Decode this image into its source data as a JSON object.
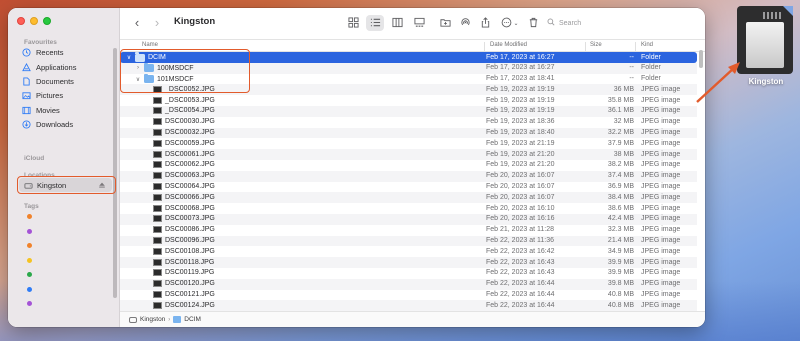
{
  "window": {
    "title": "Kingston",
    "search_placeholder": "Search"
  },
  "sidebar": {
    "favourites_label": "Favourites",
    "favourites": [
      {
        "label": "Recents",
        "icon": "clock-icon"
      },
      {
        "label": "Applications",
        "icon": "applications-icon"
      },
      {
        "label": "Documents",
        "icon": "document-icon"
      },
      {
        "label": "Pictures",
        "icon": "pictures-icon"
      },
      {
        "label": "Movies",
        "icon": "film-icon"
      },
      {
        "label": "Downloads",
        "icon": "download-icon"
      }
    ],
    "icloud_label": "iCloud",
    "locations_label": "Locations",
    "location": {
      "label": "Kingston",
      "icon": "external-drive-icon"
    },
    "tags_label": "Tags",
    "tag_colors": [
      "#f0822b",
      "#a453d6",
      "#f0822b",
      "#f5c321",
      "#2aa84a",
      "#2f7cf6",
      "#a453d6"
    ]
  },
  "columns": {
    "name": "Name",
    "date": "Date Modified",
    "size": "Size",
    "kind": "Kind"
  },
  "rows": [
    {
      "name": "DCIM",
      "date": "Feb 17, 2023 at 16:27",
      "size": "--",
      "kind": "Folder",
      "type": "folder",
      "indent": 0,
      "chevron": "down",
      "selected": true
    },
    {
      "name": "100MSDCF",
      "date": "Feb 17, 2023 at 16:27",
      "size": "--",
      "kind": "Folder",
      "type": "folder",
      "indent": 1,
      "chevron": "right"
    },
    {
      "name": "101MSDCF",
      "date": "Feb 17, 2023 at 18:41",
      "size": "--",
      "kind": "Folder",
      "type": "folder",
      "indent": 1,
      "chevron": "down"
    },
    {
      "name": "_DSC0052.JPG",
      "date": "Feb 19, 2023 at 19:19",
      "size": "36 MB",
      "kind": "JPEG image",
      "type": "image",
      "indent": 2
    },
    {
      "name": "_DSC0053.JPG",
      "date": "Feb 19, 2023 at 19:19",
      "size": "35.8 MB",
      "kind": "JPEG image",
      "type": "image",
      "indent": 2
    },
    {
      "name": "_DSC0054.JPG",
      "date": "Feb 19, 2023 at 19:19",
      "size": "36.1 MB",
      "kind": "JPEG image",
      "type": "image",
      "indent": 2
    },
    {
      "name": "DSC00030.JPG",
      "date": "Feb 19, 2023 at 18:36",
      "size": "32 MB",
      "kind": "JPEG image",
      "type": "image",
      "indent": 2
    },
    {
      "name": "DSC00032.JPG",
      "date": "Feb 19, 2023 at 18:40",
      "size": "32.2 MB",
      "kind": "JPEG image",
      "type": "image",
      "indent": 2
    },
    {
      "name": "DSC00059.JPG",
      "date": "Feb 19, 2023 at 21:19",
      "size": "37.9 MB",
      "kind": "JPEG image",
      "type": "image",
      "indent": 2
    },
    {
      "name": "DSC00061.JPG",
      "date": "Feb 19, 2023 at 21:20",
      "size": "38 MB",
      "kind": "JPEG image",
      "type": "image",
      "indent": 2
    },
    {
      "name": "DSC00062.JPG",
      "date": "Feb 19, 2023 at 21:20",
      "size": "38.2 MB",
      "kind": "JPEG image",
      "type": "image",
      "indent": 2
    },
    {
      "name": "DSC00063.JPG",
      "date": "Feb 20, 2023 at 16:07",
      "size": "37.4 MB",
      "kind": "JPEG image",
      "type": "image",
      "indent": 2
    },
    {
      "name": "DSC00064.JPG",
      "date": "Feb 20, 2023 at 16:07",
      "size": "36.9 MB",
      "kind": "JPEG image",
      "type": "image",
      "indent": 2
    },
    {
      "name": "DSC00066.JPG",
      "date": "Feb 20, 2023 at 16:07",
      "size": "38.4 MB",
      "kind": "JPEG image",
      "type": "image",
      "indent": 2
    },
    {
      "name": "DSC00068.JPG",
      "date": "Feb 20, 2023 at 16:10",
      "size": "38.6 MB",
      "kind": "JPEG image",
      "type": "image",
      "indent": 2
    },
    {
      "name": "DSC00073.JPG",
      "date": "Feb 20, 2023 at 16:16",
      "size": "42.4 MB",
      "kind": "JPEG image",
      "type": "image",
      "indent": 2
    },
    {
      "name": "DSC00086.JPG",
      "date": "Feb 21, 2023 at 11:28",
      "size": "32.3 MB",
      "kind": "JPEG image",
      "type": "image",
      "indent": 2
    },
    {
      "name": "DSC00096.JPG",
      "date": "Feb 22, 2023 at 11:36",
      "size": "21.4 MB",
      "kind": "JPEG image",
      "type": "image",
      "indent": 2
    },
    {
      "name": "DSC00108.JPG",
      "date": "Feb 22, 2023 at 16:42",
      "size": "34.9 MB",
      "kind": "JPEG image",
      "type": "image",
      "indent": 2
    },
    {
      "name": "DSC00118.JPG",
      "date": "Feb 22, 2023 at 16:43",
      "size": "39.9 MB",
      "kind": "JPEG image",
      "type": "image",
      "indent": 2
    },
    {
      "name": "DSC00119.JPG",
      "date": "Feb 22, 2023 at 16:43",
      "size": "39.9 MB",
      "kind": "JPEG image",
      "type": "image",
      "indent": 2
    },
    {
      "name": "DSC00120.JPG",
      "date": "Feb 22, 2023 at 16:44",
      "size": "39.8 MB",
      "kind": "JPEG image",
      "type": "image",
      "indent": 2
    },
    {
      "name": "DSC00121.JPG",
      "date": "Feb 22, 2023 at 16:44",
      "size": "40.8 MB",
      "kind": "JPEG image",
      "type": "image",
      "indent": 2
    },
    {
      "name": "DSC00124.JPG",
      "date": "Feb 22, 2023 at 16:44",
      "size": "40.8 MB",
      "kind": "JPEG image",
      "type": "image",
      "indent": 2
    }
  ],
  "pathbar": {
    "items": [
      {
        "label": "Kingston",
        "icon": "external-drive-icon"
      },
      {
        "label": "DCIM",
        "icon": "folder-icon"
      }
    ]
  },
  "desktop": {
    "drive_label": "Kingston"
  },
  "colors": {
    "accent": "#2b64df",
    "highlight": "#e25b2c"
  }
}
